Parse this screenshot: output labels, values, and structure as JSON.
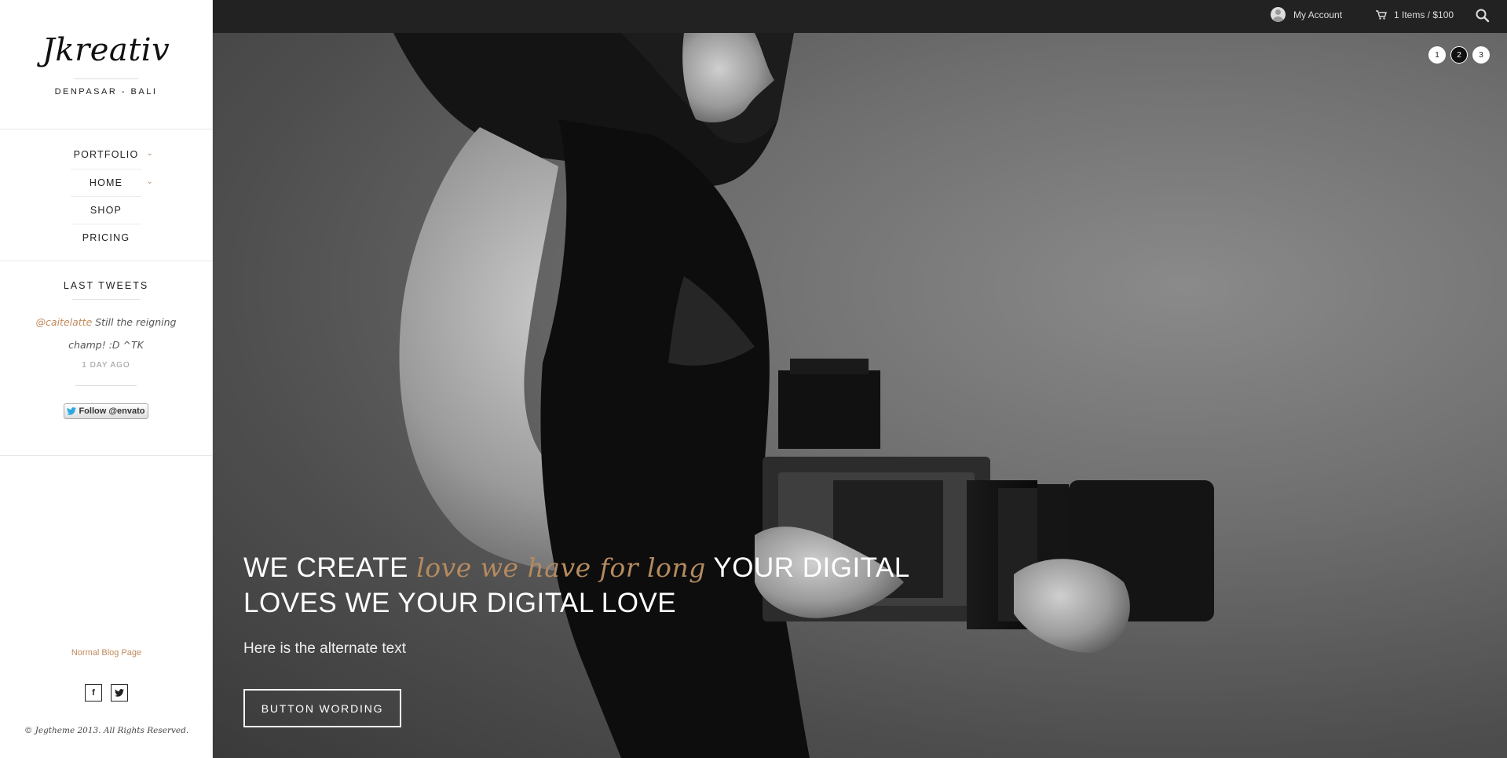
{
  "sidebar": {
    "logo": "Jkreativ",
    "tagline": "DENPASAR - BALI",
    "nav": [
      {
        "label": "PORTFOLIO",
        "has_submenu": true
      },
      {
        "label": "HOME",
        "has_submenu": true
      },
      {
        "label": "SHOP",
        "has_submenu": false
      },
      {
        "label": "PRICING",
        "has_submenu": false
      }
    ],
    "tweets": {
      "title": "LAST TWEETS",
      "handle": "@caitelatte",
      "text": " Still the reigning champ! :D ^TK",
      "time": "1 DAY AGO",
      "follow_label": "Follow @envato"
    },
    "footer_link": "Normal Blog Page",
    "social": [
      {
        "icon": "facebook-icon",
        "glyph": "f"
      },
      {
        "icon": "twitter-icon",
        "glyph": "t"
      }
    ],
    "copyright": "© Jegtheme 2013. All Rights Reserved."
  },
  "topbar": {
    "account_label": "My Account",
    "cart_label": "1 Items / $100",
    "search_icon": "search-icon"
  },
  "hero": {
    "slides": [
      "1",
      "2",
      "3"
    ],
    "active_slide": 2,
    "heading_part1": "WE CREATE ",
    "heading_accent": "love we have for long",
    "heading_part2": " YOUR DIGITAL LOVES WE YOUR DIGITAL LOVE",
    "subtext": "Here is the alternate text",
    "button_label": "BUTTON WORDING"
  },
  "colors": {
    "accent": "#b58a5f",
    "topbar_bg": "#222222",
    "link": "#c08a5c"
  }
}
